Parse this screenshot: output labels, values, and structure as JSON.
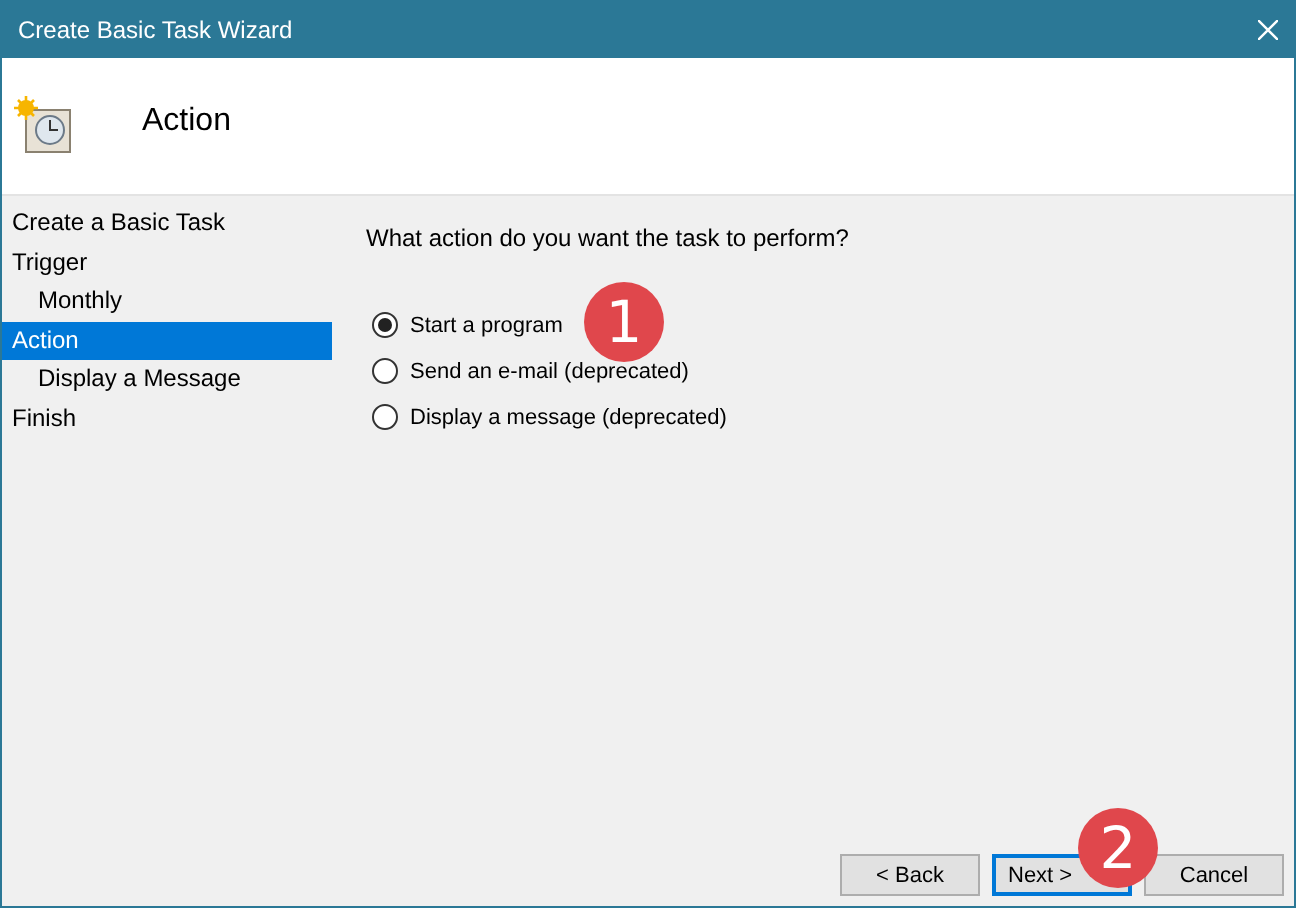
{
  "window": {
    "title": "Create Basic Task Wizard"
  },
  "header": {
    "title": "Action"
  },
  "sidebar": {
    "items": [
      {
        "label": "Create a Basic Task",
        "selected": false
      },
      {
        "label": "Trigger",
        "selected": false,
        "children": [
          {
            "label": "Monthly",
            "selected": false
          }
        ]
      },
      {
        "label": "Action",
        "selected": true,
        "children": [
          {
            "label": "Display a Message",
            "selected": false
          }
        ]
      },
      {
        "label": "Finish",
        "selected": false
      }
    ]
  },
  "question": "What action do you want the task to perform?",
  "options": [
    {
      "label": "Start a program",
      "selected": true
    },
    {
      "label": "Send an e-mail (deprecated)",
      "selected": false
    },
    {
      "label": "Display a message (deprecated)",
      "selected": false
    }
  ],
  "buttons": [
    {
      "label": "< Back",
      "default": false
    },
    {
      "label": "Next >",
      "default": true
    },
    {
      "label": "Cancel",
      "default": false
    }
  ],
  "badges": [
    "1",
    "2"
  ]
}
